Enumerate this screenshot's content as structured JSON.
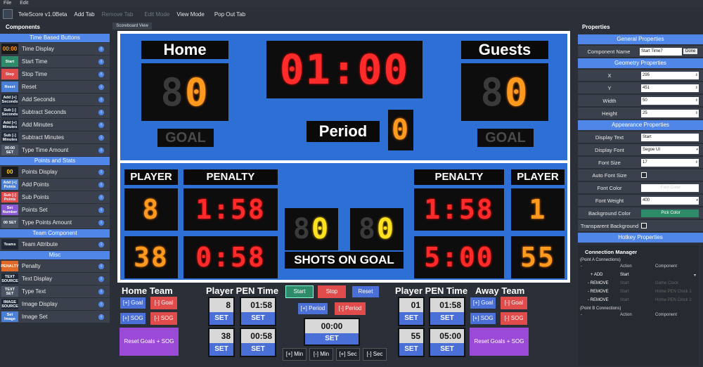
{
  "menu": {
    "file": "File",
    "edit": "Edit"
  },
  "toolbar": {
    "app_title": "TeleScore v1.0Beta",
    "add_tab": "Add Tab",
    "remove_tab": "Remove Tab",
    "edit_mode": "Edit Mode",
    "view_mode": "View Mode",
    "pop_out": "Pop Out Tab"
  },
  "components": {
    "title": "Components",
    "sec_time": "Time Based Buttons",
    "time_items": [
      {
        "icon": "00:00",
        "label": "Time Display"
      },
      {
        "icon": "Start",
        "label": "Start Time"
      },
      {
        "icon": "Stop",
        "label": "Stop Time"
      },
      {
        "icon": "Reset",
        "label": "Reset"
      },
      {
        "icon": "Add [+] Seconds",
        "label": "Add Seconds"
      },
      {
        "icon": "Sub [-] Seconds",
        "label": "Subtract Seconds"
      },
      {
        "icon": "Add [+] Minutes",
        "label": "Add Minutes"
      },
      {
        "icon": "Sub [-] Minutes",
        "label": "Subtract Minutes"
      },
      {
        "icon": "00:00 SET",
        "label": "Type Time Amount"
      }
    ],
    "sec_points": "Points and Stats",
    "point_items": [
      {
        "icon": "00",
        "label": "Points Display"
      },
      {
        "icon": "Add [+] Points",
        "label": "Add Points"
      },
      {
        "icon": "Sub [-] Points",
        "label": "Sub Points"
      },
      {
        "icon": "Set Number",
        "label": "Points Set"
      },
      {
        "icon": "00 SET",
        "label": "Type Points Amount"
      }
    ],
    "sec_team": "Team Component",
    "team_items": [
      {
        "icon": "Teams",
        "label": "Team Attribute"
      }
    ],
    "sec_misc": "Misc",
    "misc_items": [
      {
        "icon": "PENALTY",
        "label": "Penalty"
      },
      {
        "icon": "TEXT SOURCE",
        "label": "Text Display"
      },
      {
        "icon": "TEXT SET",
        "label": "Type Text"
      },
      {
        "icon": "IMAGE SOURCE",
        "label": "Image Display"
      },
      {
        "icon": "Set Image",
        "label": "Image Set"
      }
    ]
  },
  "scoreboard": {
    "tab_label": "Scoreboard View",
    "home_label": "Home",
    "guests_label": "Guests",
    "home_score": "0",
    "guests_score": "0",
    "clock": "01:00",
    "period_label": "Period",
    "period": "0",
    "goal_label": "GOAL",
    "player_label": "PLAYER",
    "penalty_label": "PENALTY",
    "shots_label": "SHOTS ON GOAL",
    "home_players": [
      "8",
      "38"
    ],
    "home_penalties": [
      "1:58",
      "0:58"
    ],
    "away_players": [
      "1",
      "55"
    ],
    "away_penalties": [
      "1:58",
      "5:00"
    ],
    "home_shots": "0",
    "away_shots": "0"
  },
  "controls": {
    "home_team": "Home Team",
    "away_team": "Away Team",
    "player_pen_time": "Player PEN Time",
    "add_goal": "[+] Goal",
    "sub_goal": "[-] Goal",
    "add_sog": "[+] SOG",
    "sub_sog": "[-] SOG",
    "reset_goals": "Reset Goals + SOG",
    "start": "Start",
    "stop": "Stop",
    "reset": "Reset",
    "add_period": "[+] Period",
    "sub_period": "[-] Period",
    "time_value": "00:00",
    "set": "SET",
    "add_min": "[+] Min",
    "sub_min": "[-] Min",
    "add_sec": "[+] Sec",
    "sub_sec": "[-] Sec",
    "home_pen": [
      {
        "player": "8",
        "time": "01:58"
      },
      {
        "player": "38",
        "time": "00:58"
      }
    ],
    "away_pen": [
      {
        "player": "01",
        "time": "01:58"
      },
      {
        "player": "55",
        "time": "05:00"
      }
    ]
  },
  "properties": {
    "title": "Properties",
    "general": "General Properties",
    "component_name_label": "Component Name",
    "component_name": "Start Time7",
    "done": "Done",
    "geometry": "Geometry Properties",
    "x_label": "X",
    "x": "295",
    "y_label": "Y",
    "y": "451",
    "width_label": "Width",
    "width": "50",
    "height_label": "Height",
    "height": "25",
    "appearance": "Appearance Properties",
    "display_text_label": "Display Text",
    "display_text": "Start",
    "display_font_label": "Display Font",
    "display_font": "Segoe UI",
    "font_size_label": "Font Size",
    "font_size": "17",
    "auto_font_label": "Auto Font Size",
    "font_color_label": "Font Color",
    "font_color_btn": "Font Color",
    "font_weight_label": "Font Weight",
    "font_weight": "400",
    "bg_color_label": "Background Color",
    "bg_color_btn": "Pick Color",
    "transparent_label": "Transparent Background",
    "hotkey": "Hotkey Properties"
  },
  "connections": {
    "title": "Connection Manager",
    "point_a": "(Point A Connections)",
    "point_b": "(Point B Connections)",
    "col_action": "Action",
    "col_component": "Component",
    "add": "+ ADD",
    "add_action": "Start",
    "remove": "- REMOVE",
    "rows": [
      {
        "action": "Start",
        "component": "Game Clock"
      },
      {
        "action": "Start",
        "component": "Home PEN Clock 1"
      },
      {
        "action": "Start",
        "component": "Home PEN Clock 2"
      }
    ]
  },
  "colors": {
    "accent": "#4f86e8",
    "board": "#2e6fd6",
    "led_orange": "#ff9a1f",
    "led_red": "#ff2a2a",
    "led_yellow": "#ffe21f"
  }
}
